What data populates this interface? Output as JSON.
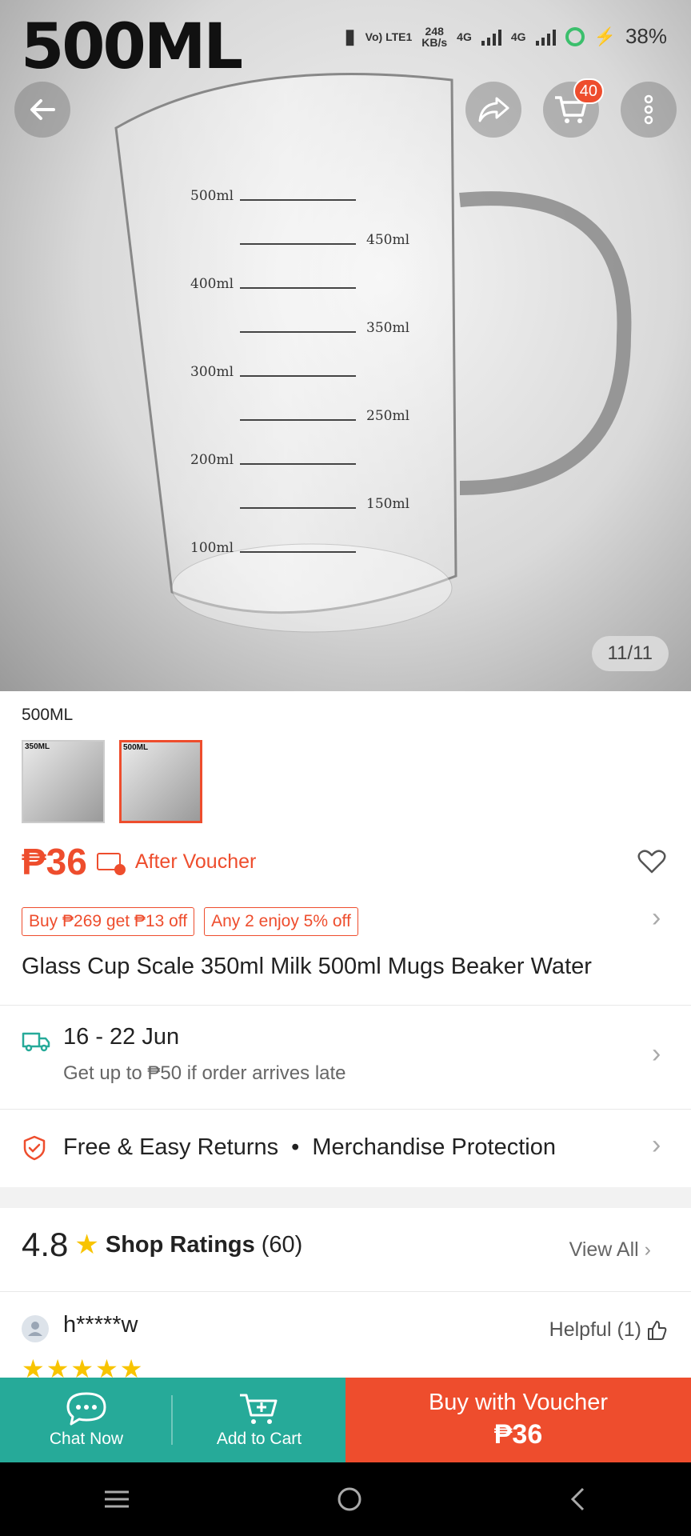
{
  "hero": {
    "overlay_label": "500ML",
    "image_counter": "11/11",
    "cart_badge": "40",
    "scale_labels": [
      "500ml",
      "450ml",
      "400ml",
      "350ml",
      "300ml",
      "250ml",
      "200ml",
      "150ml",
      "100ml"
    ]
  },
  "status_bar": {
    "network": "Vo) LTE1",
    "speed_value": "248",
    "speed_unit": "KB/s",
    "signal_1": "4G",
    "signal_2": "4G",
    "battery": "38%"
  },
  "variation": {
    "selected_label": "500ML",
    "options": [
      {
        "label": "350ML",
        "selected": false
      },
      {
        "label": "500ML",
        "selected": true
      }
    ]
  },
  "price": {
    "amount": "₱36",
    "after_voucher": "After Voucher"
  },
  "promos": [
    "Buy ₱269 get ₱13 off",
    "Any 2 enjoy 5% off"
  ],
  "product_title": "Glass Cup Scale 350ml Milk 500ml Mugs Beaker Water",
  "shipping": {
    "date_range": "16 - 22 Jun",
    "guarantee": "Get up to ₱50 if order arrives late"
  },
  "returns": {
    "item1": "Free & Easy Returns",
    "separator": "•",
    "item2": "Merchandise Protection"
  },
  "ratings": {
    "value": "4.8",
    "label": "Shop Ratings",
    "count": "(60)",
    "view_all": "View All"
  },
  "review": {
    "reviewer": "h*****w",
    "helpful": "Helpful (1)",
    "stars": 5
  },
  "bottom_bar": {
    "chat": "Chat Now",
    "add_to_cart": "Add to Cart",
    "buy_line1": "Buy with Voucher",
    "buy_line2": "₱36"
  },
  "colors": {
    "accent": "#ee4d2d",
    "green": "#26aa99",
    "star": "#f8c400"
  }
}
